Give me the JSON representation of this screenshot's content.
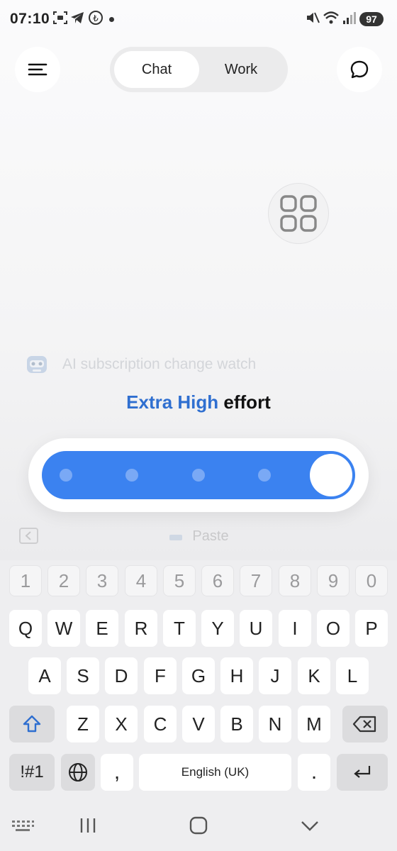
{
  "status_bar": {
    "time": "07:10",
    "battery": "97"
  },
  "header": {
    "tabs": [
      {
        "label": "Chat",
        "active": true
      },
      {
        "label": "Work",
        "active": false
      }
    ]
  },
  "suggestion": {
    "text": "AI subscription change watch"
  },
  "effort": {
    "level": "Extra High",
    "word": "effort",
    "steps": 5,
    "selected_step": 5,
    "accent": "#3b82f0"
  },
  "keyboard_toolbar": {
    "paste_label": "Paste"
  },
  "keyboard": {
    "number_row": [
      "1",
      "2",
      "3",
      "4",
      "5",
      "6",
      "7",
      "8",
      "9",
      "0"
    ],
    "row1": [
      "Q",
      "W",
      "E",
      "R",
      "T",
      "Y",
      "U",
      "I",
      "O",
      "P"
    ],
    "row2": [
      "A",
      "S",
      "D",
      "F",
      "G",
      "H",
      "J",
      "K",
      "L"
    ],
    "row3": [
      "Z",
      "X",
      "C",
      "V",
      "B",
      "N",
      "M"
    ],
    "symbols_label": "!#1",
    "comma": ",",
    "space_label": "English (UK)",
    "period": "."
  }
}
